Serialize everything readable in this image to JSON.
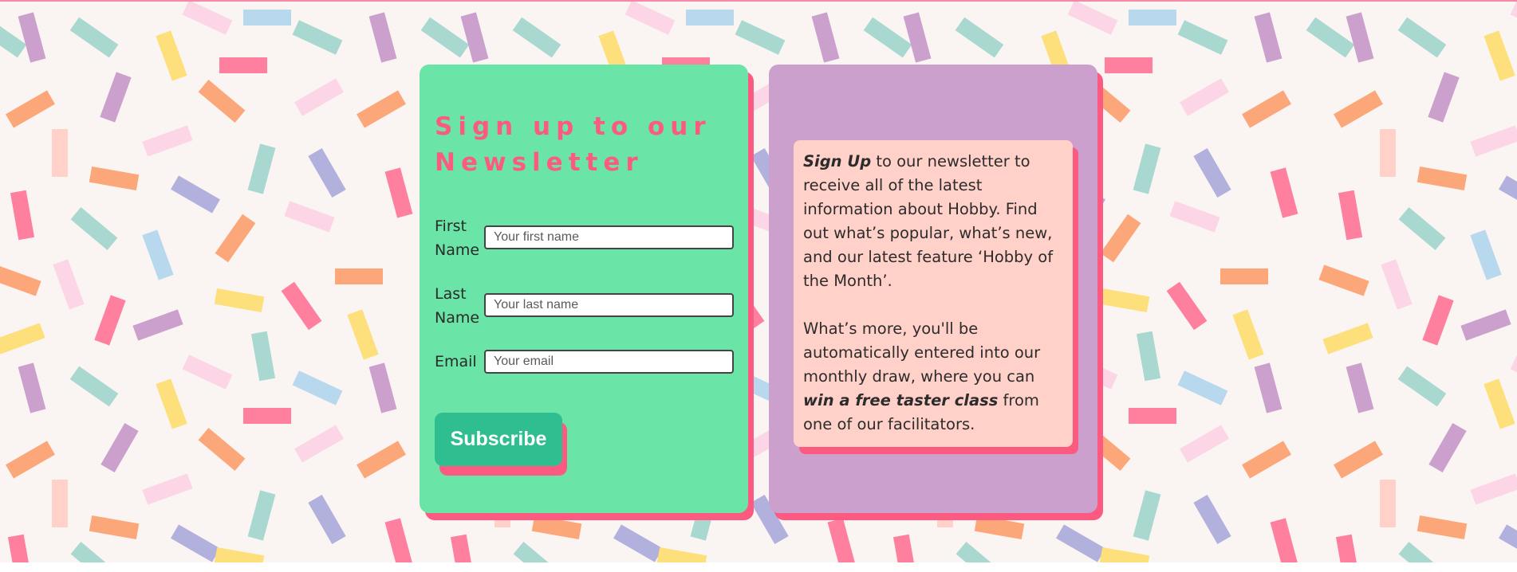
{
  "colors": {
    "background": "#faf5f2",
    "signup_card": "#6be5a7",
    "info_card": "#cba0cc",
    "info_box": "#ffd1c8",
    "accent_pink": "#fc5a81",
    "button": "#2fbe8f",
    "sprinkle_palette": [
      "#cba0cc",
      "#a8d8cf",
      "#fde07b",
      "#fcd6e6",
      "#b8d8ee",
      "#ff7f9f",
      "#fca77a",
      "#b2b0dd",
      "#ffd1c8"
    ]
  },
  "signup": {
    "title": "Sign up to our Newsletter",
    "fields": [
      {
        "label": "First Name",
        "placeholder": "Your first name",
        "value": ""
      },
      {
        "label": "Last Name",
        "placeholder": "Your last name",
        "value": ""
      },
      {
        "label": "Email",
        "placeholder": "Your email",
        "value": ""
      }
    ],
    "subscribe_label": "Subscribe"
  },
  "info": {
    "p1_emph": "Sign Up",
    "p1_rest": " to our newsletter to receive all of the latest information about Hobby. Find out what’s popular, what’s new, and our latest feature ‘Hobby of the Month’.",
    "p2_start": "What’s more, you'll be automatically entered into our monthly draw, where you can ",
    "p2_emph": "win a free taster class",
    "p2_end": " from one of our facilitators."
  }
}
